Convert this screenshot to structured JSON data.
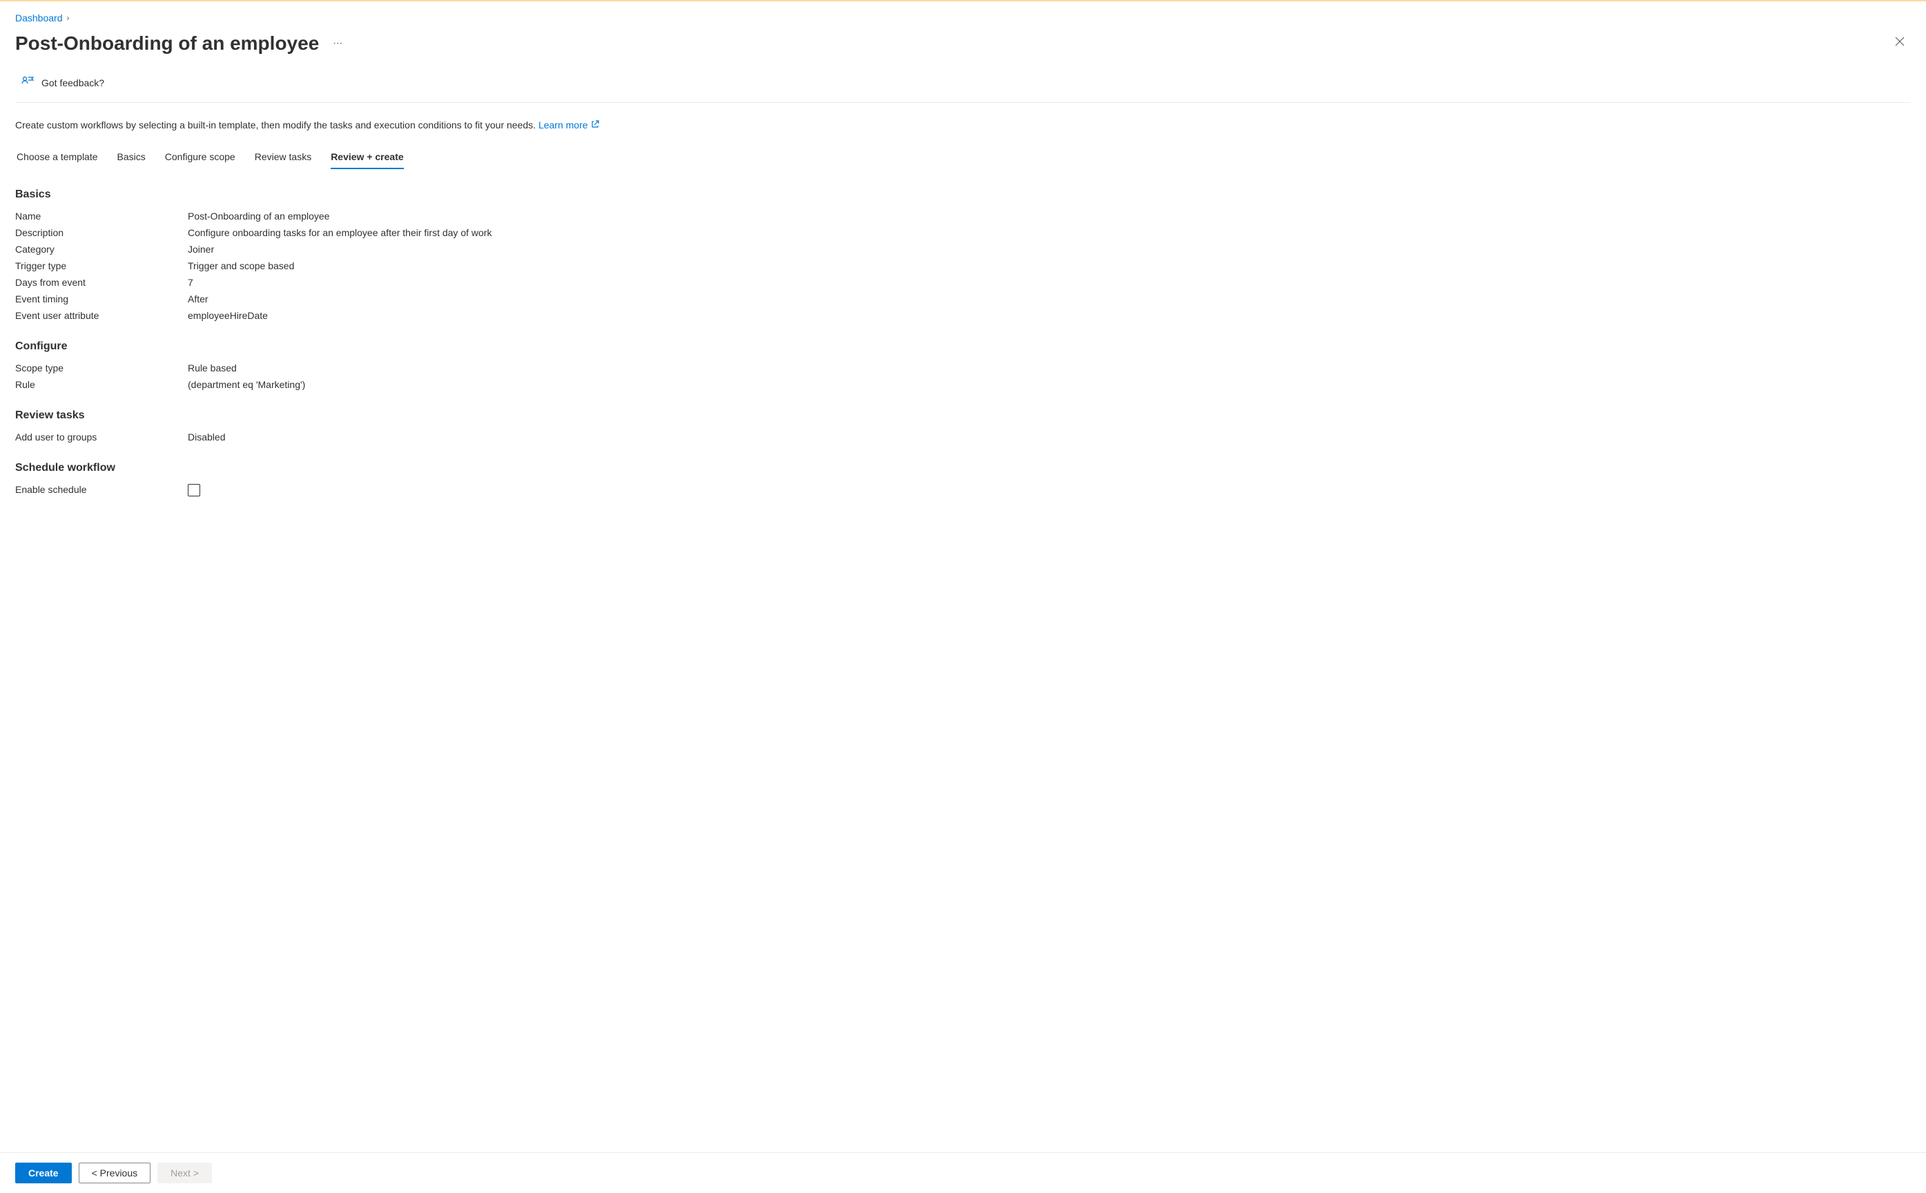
{
  "breadcrumb": {
    "link": "Dashboard"
  },
  "page_title": "Post-Onboarding of an employee",
  "feedback_label": "Got feedback?",
  "description_text": "Create custom workflows by selecting a built-in template, then modify the tasks and execution conditions to fit your needs.",
  "learn_more_label": "Learn more",
  "tabs": {
    "choose_template": "Choose a template",
    "basics": "Basics",
    "configure_scope": "Configure scope",
    "review_tasks": "Review tasks",
    "review_create": "Review + create"
  },
  "sections": {
    "basics": {
      "heading": "Basics",
      "rows": {
        "name": {
          "label": "Name",
          "value": "Post-Onboarding of an employee"
        },
        "description": {
          "label": "Description",
          "value": "Configure onboarding tasks for an employee after their first day of work"
        },
        "category": {
          "label": "Category",
          "value": "Joiner"
        },
        "trigger_type": {
          "label": "Trigger type",
          "value": "Trigger and scope based"
        },
        "days_from_event": {
          "label": "Days from event",
          "value": "7"
        },
        "event_timing": {
          "label": "Event timing",
          "value": "After"
        },
        "event_user_attribute": {
          "label": "Event user attribute",
          "value": "employeeHireDate"
        }
      }
    },
    "configure": {
      "heading": "Configure",
      "rows": {
        "scope_type": {
          "label": "Scope type",
          "value": "Rule based"
        },
        "rule": {
          "label": "Rule",
          "value": "(department eq 'Marketing')"
        }
      }
    },
    "review_tasks": {
      "heading": "Review tasks",
      "rows": {
        "add_user_to_groups": {
          "label": "Add user to groups",
          "value": "Disabled"
        }
      }
    },
    "schedule_workflow": {
      "heading": "Schedule workflow",
      "enable_schedule_label": "Enable schedule"
    }
  },
  "footer": {
    "create": "Create",
    "previous": "< Previous",
    "next": "Next >"
  }
}
